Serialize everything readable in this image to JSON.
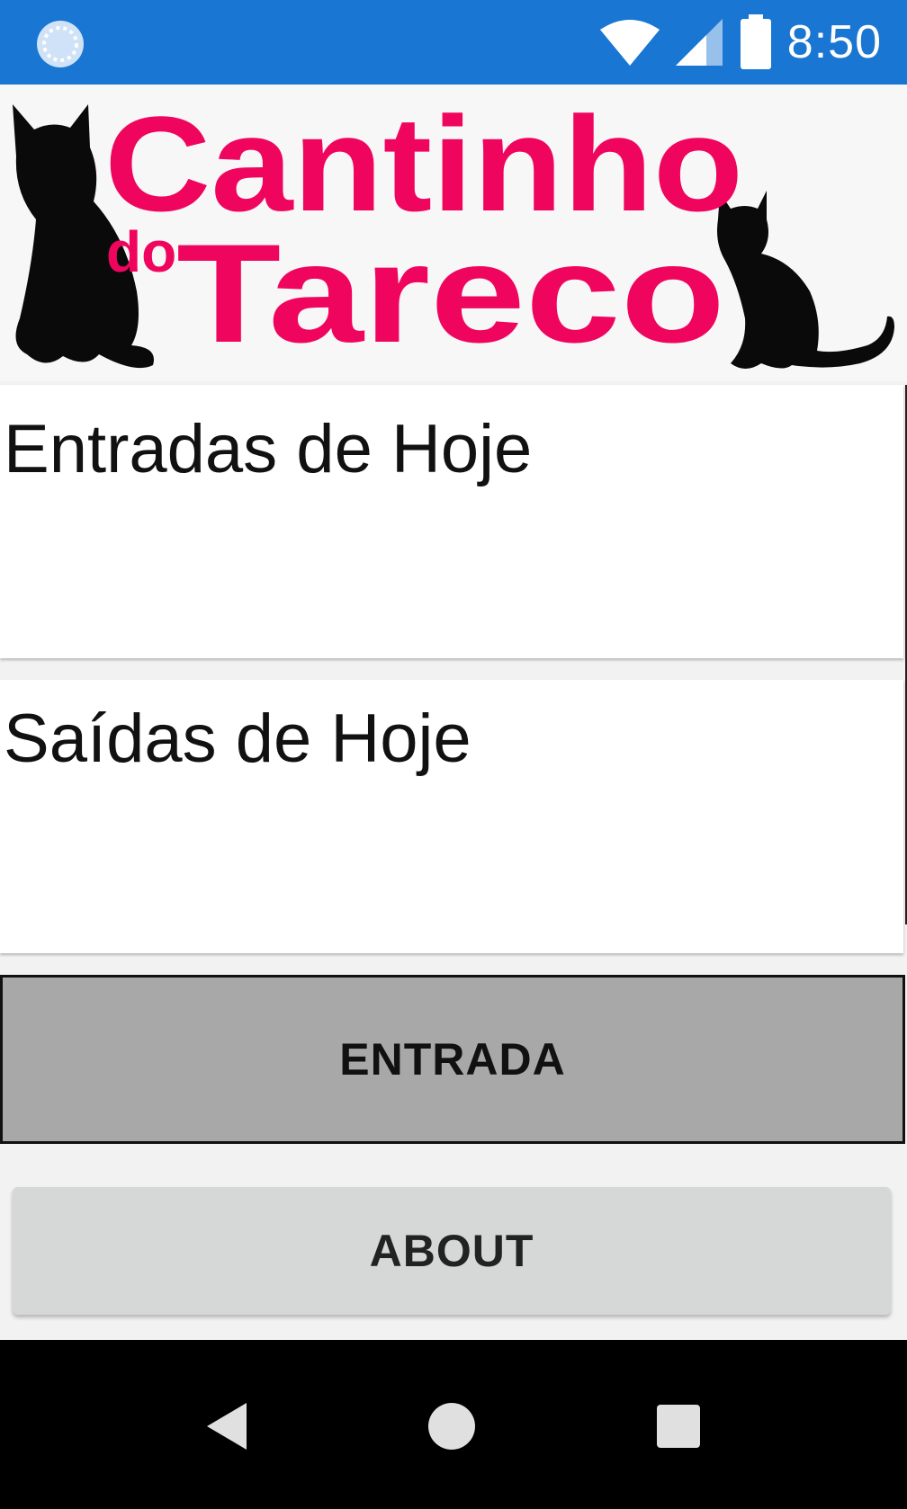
{
  "status_bar": {
    "time": "8:50",
    "color": "#1976d2",
    "left_icon": "sync-circle-icon",
    "icons": [
      "wifi-icon",
      "cell-signal-icon",
      "battery-icon"
    ]
  },
  "banner": {
    "title_line1": "Cantinho",
    "title_small": "do",
    "title_line2": "Tareco",
    "title_color": "#f0055e",
    "icons": [
      "cat-silhouette-left-icon",
      "cat-silhouette-right-icon"
    ]
  },
  "sections": {
    "entradas_title": "Entradas de Hoje",
    "saidas_title": "Saídas de Hoje"
  },
  "buttons": {
    "entrada_label": "ENTRADA",
    "about_label": "ABOUT"
  },
  "nav_bar": {
    "icons": [
      "back-icon",
      "home-icon",
      "recents-icon"
    ]
  }
}
